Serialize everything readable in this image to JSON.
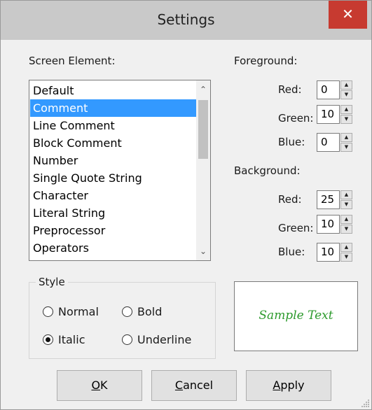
{
  "window": {
    "title": "Settings",
    "close_glyph": "✕"
  },
  "screen_element": {
    "label": "Screen Element:",
    "items": [
      "Default",
      "Comment",
      "Line Comment",
      "Block Comment",
      "Number",
      "Single Quote String",
      "Character",
      "Literal String",
      "Preprocessor",
      "Operators"
    ],
    "selected": "Comment"
  },
  "foreground": {
    "label": "Foreground:",
    "red": {
      "label": "Red:",
      "value": "0"
    },
    "green": {
      "label": "Green:",
      "value": "10"
    },
    "blue": {
      "label": "Blue:",
      "value": "0"
    }
  },
  "background": {
    "label": "Background:",
    "red": {
      "label": "Red:",
      "value": "25"
    },
    "green": {
      "label": "Green:",
      "value": "10"
    },
    "blue": {
      "label": "Blue:",
      "value": "10"
    }
  },
  "style": {
    "label": "Style",
    "options": [
      {
        "key": "normal",
        "label": "Normal",
        "checked": false
      },
      {
        "key": "bold",
        "label": "Bold",
        "checked": false
      },
      {
        "key": "italic",
        "label": "Italic",
        "checked": true
      },
      {
        "key": "underline",
        "label": "Underline",
        "checked": false
      }
    ]
  },
  "preview": {
    "text": "Sample Text",
    "color": "#2d9a2d"
  },
  "buttons": {
    "ok": {
      "label": "OK",
      "mnemonic": "O",
      "rest": "K"
    },
    "cancel": {
      "label": "Cancel",
      "mnemonic": "C",
      "rest": "ancel"
    },
    "apply": {
      "label": "Apply",
      "mnemonic": "A",
      "rest": "pply"
    }
  },
  "icons": {
    "scroll_up": "chevron-up-icon",
    "scroll_down": "chevron-down-icon",
    "spin_up": "triangle-up-icon",
    "spin_down": "triangle-down-icon",
    "close": "close-icon"
  }
}
